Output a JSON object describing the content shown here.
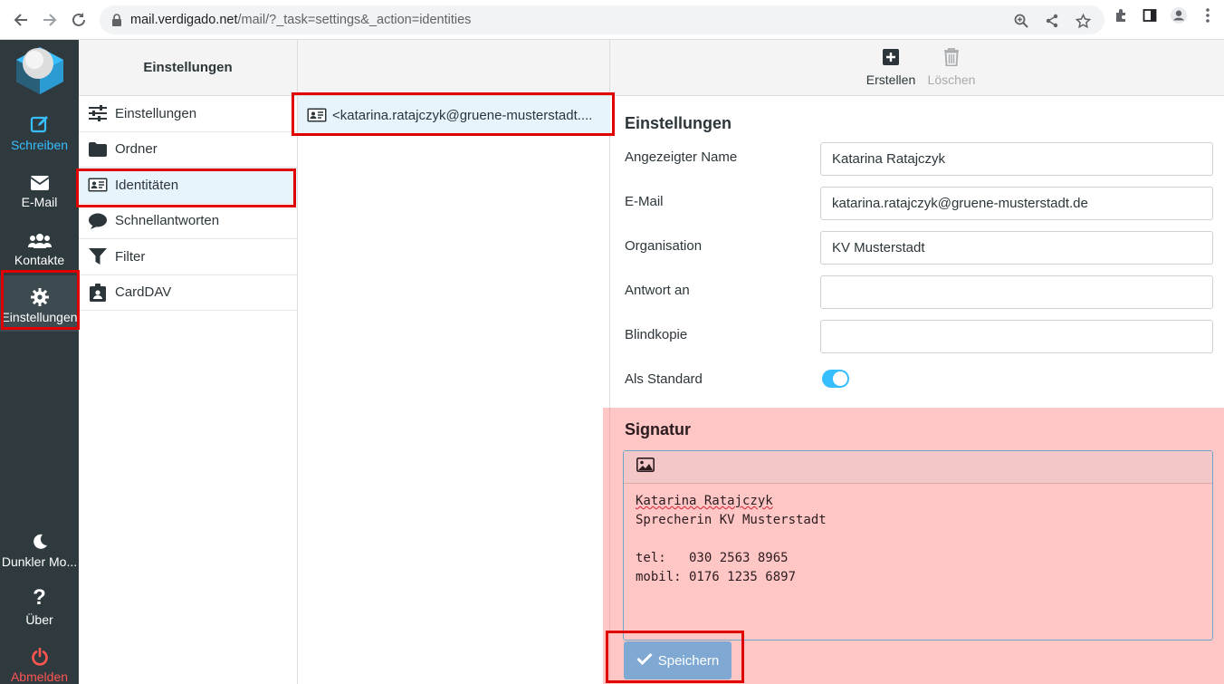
{
  "browser": {
    "url_host": "mail.verdigado.net",
    "url_rest": "/mail/?_task=settings&_action=identities"
  },
  "sidebar": {
    "items": [
      {
        "label": "Schreiben",
        "icon": "compose-icon"
      },
      {
        "label": "E-Mail",
        "icon": "envelope-icon"
      },
      {
        "label": "Kontakte",
        "icon": "users-icon"
      },
      {
        "label": "Einstellungen",
        "icon": "gear-icon"
      }
    ],
    "bottom": [
      {
        "label": "Dunkler Mo...",
        "icon": "moon-icon"
      },
      {
        "label": "Über",
        "icon": "question-icon"
      },
      {
        "label": "Abmelden",
        "icon": "power-icon"
      }
    ]
  },
  "settings": {
    "header": "Einstellungen",
    "items": [
      {
        "label": "Einstellungen",
        "icon": "sliders-icon"
      },
      {
        "label": "Ordner",
        "icon": "folder-icon"
      },
      {
        "label": "Identitäten",
        "icon": "id-card-icon"
      },
      {
        "label": "Schnellantworten",
        "icon": "comment-icon"
      },
      {
        "label": "Filter",
        "icon": "filter-icon"
      },
      {
        "label": "CardDAV",
        "icon": "address-book-icon"
      }
    ]
  },
  "identities": {
    "item": "<katarina.ratajczyk@gruene-musterstadt...."
  },
  "toolbar": {
    "create": "Erstellen",
    "delete": "Löschen"
  },
  "form": {
    "section_title": "Einstellungen",
    "name_label": "Angezeigter Name",
    "name_value": "Katarina Ratajczyk",
    "email_label": "E-Mail",
    "email_value": "katarina.ratajczyk@gruene-musterstadt.de",
    "org_label": "Organisation",
    "org_value": "KV Musterstadt",
    "reply_label": "Antwort an",
    "reply_value": "",
    "bcc_label": "Blindkopie",
    "bcc_value": "",
    "default_label": "Als Standard",
    "default_on": true
  },
  "signature": {
    "title": "Signatur",
    "line1": "Katarina Ratajczyk",
    "line2": "Sprecherin KV Musterstadt",
    "line3": "",
    "line4": "tel:   030 2563 8965",
    "line5": "mobil: 0176 1235 6897",
    "save": "Speichern"
  },
  "colors": {
    "accent": "#37beff",
    "sidebar_bg": "#2f3a3f",
    "highlight": "#e00000",
    "logout": "#ff5552"
  }
}
